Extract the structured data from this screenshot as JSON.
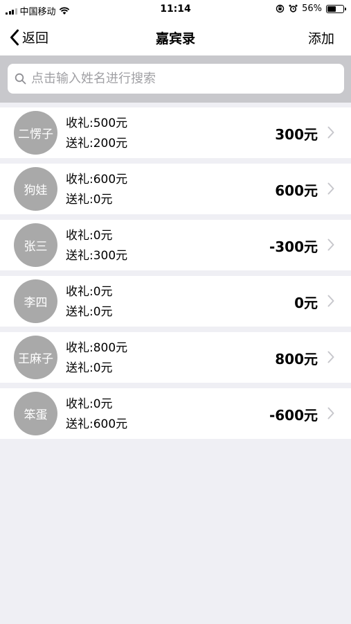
{
  "status_bar": {
    "carrier": "中国移动",
    "time": "11:14",
    "battery": "56%",
    "battery_level": 0.56
  },
  "nav": {
    "back_label": "返回",
    "title": "嘉宾录",
    "add_label": "添加"
  },
  "search": {
    "placeholder": "点击输入姓名进行搜索"
  },
  "guests": [
    {
      "name": "二愣子",
      "received": "收礼:500元",
      "given": "送礼:200元",
      "net": "300元"
    },
    {
      "name": "狗娃",
      "received": "收礼:600元",
      "given": "送礼:0元",
      "net": "600元"
    },
    {
      "name": "张三",
      "received": "收礼:0元",
      "given": "送礼:300元",
      "net": "-300元"
    },
    {
      "name": "李四",
      "received": "收礼:0元",
      "given": "送礼:0元",
      "net": "0元"
    },
    {
      "name": "王麻子",
      "received": "收礼:800元",
      "given": "送礼:0元",
      "net": "800元"
    },
    {
      "name": "笨蛋",
      "received": "收礼:0元",
      "given": "送礼:600元",
      "net": "-600元"
    }
  ],
  "colors": {
    "background": "#efeff4",
    "avatar": "#a9a9a9",
    "search_bar": "#c8c8cc",
    "chevron": "#c7c7cc"
  }
}
